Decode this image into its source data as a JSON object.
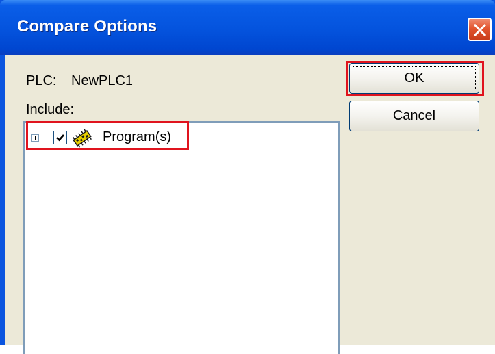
{
  "dialog": {
    "title": "Compare Options",
    "plc_label": "PLC:",
    "plc_value": "NewPLC1",
    "include_label": "Include:"
  },
  "tree": {
    "items": [
      {
        "label": "Program(s)",
        "checked": true,
        "expanded": false,
        "icon": "program-icon"
      }
    ]
  },
  "buttons": {
    "ok_label": "OK",
    "cancel_label": "Cancel"
  },
  "colors": {
    "titlebar": "#0453dd",
    "client": "#ece9d8",
    "highlight": "#e0141e"
  }
}
